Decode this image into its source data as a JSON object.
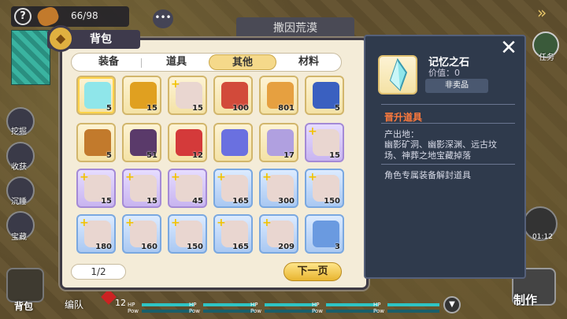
{
  "hud": {
    "help_label": "?",
    "resource_count": "66/98",
    "chat_label": "•••",
    "area_banner": "撒因荒漠",
    "task_label": "任务",
    "timer": "01:12",
    "craft_label": "制作",
    "bag_label": "背包",
    "team_label": "编队",
    "gem_count": "12",
    "menu_icon": "chevron-right-icon",
    "side_buttons": [
      "挖掘",
      "收获",
      "沉睡",
      "宝藏"
    ],
    "hp_label": "HP",
    "pow_label": "Pow"
  },
  "bag": {
    "title": "背包",
    "tabs": [
      {
        "label": "装备",
        "active": false
      },
      {
        "label": "道具",
        "active": false
      },
      {
        "label": "其他",
        "active": true
      },
      {
        "label": "材料",
        "active": false
      }
    ],
    "items": [
      {
        "icon": "crystal-icon",
        "count": "5",
        "rarity": "gold",
        "selected": true
      },
      {
        "icon": "medal-icon",
        "count": "15",
        "rarity": "gold"
      },
      {
        "icon": "character-portrait",
        "count": "15",
        "rarity": "gold",
        "plus": true
      },
      {
        "icon": "scroll-icon",
        "count": "100",
        "rarity": "gold"
      },
      {
        "icon": "taiyaki-icon",
        "count": "801",
        "rarity": "gold"
      },
      {
        "icon": "mushroom-icon",
        "count": "5",
        "rarity": "gold"
      },
      {
        "icon": "bread-icon",
        "count": "5",
        "rarity": "gold"
      },
      {
        "icon": "hourglass-card-icon",
        "count": "51",
        "rarity": "gold"
      },
      {
        "icon": "potion-icon",
        "count": "12",
        "rarity": "gold"
      },
      {
        "icon": "star-icon",
        "count": "",
        "rarity": "gold"
      },
      {
        "icon": "paper-icon",
        "count": "17",
        "rarity": "gold"
      },
      {
        "icon": "character-portrait",
        "count": "15",
        "rarity": "purple",
        "plus": true
      },
      {
        "icon": "character-portrait",
        "count": "15",
        "rarity": "purple",
        "plus": true
      },
      {
        "icon": "character-portrait",
        "count": "15",
        "rarity": "purple",
        "plus": true
      },
      {
        "icon": "character-portrait",
        "count": "45",
        "rarity": "purple",
        "plus": true
      },
      {
        "icon": "character-portrait",
        "count": "165",
        "rarity": "blue",
        "plus": true
      },
      {
        "icon": "character-portrait",
        "count": "300",
        "rarity": "blue",
        "plus": true
      },
      {
        "icon": "character-portrait",
        "count": "150",
        "rarity": "blue",
        "plus": true
      },
      {
        "icon": "character-portrait",
        "count": "180",
        "rarity": "blue",
        "plus": true
      },
      {
        "icon": "character-portrait",
        "count": "160",
        "rarity": "blue",
        "plus": true
      },
      {
        "icon": "character-portrait",
        "count": "150",
        "rarity": "blue",
        "plus": true
      },
      {
        "icon": "character-portrait",
        "count": "165",
        "rarity": "blue",
        "plus": true
      },
      {
        "icon": "character-portrait",
        "count": "209",
        "rarity": "blue",
        "plus": true
      },
      {
        "icon": "map-icon",
        "count": "3",
        "rarity": "blue"
      }
    ],
    "page": "1/2",
    "next_label": "下一页"
  },
  "detail": {
    "name": "记忆之石",
    "value": "价值：0",
    "sale_status": "非卖品",
    "type": "晋升道具",
    "origin_header": "产出地：",
    "origin": "幽影矿洞、幽影深渊、远古坟场、神葬之地宝藏掉落",
    "description": "角色专属装备解封道具",
    "close_icon": "close-icon"
  },
  "colors": {
    "panel_bg": "#f4ecd8",
    "detail_bg": "#2f3a4c",
    "type_color": "#ff7a3c",
    "accent": "#f5d98a"
  }
}
